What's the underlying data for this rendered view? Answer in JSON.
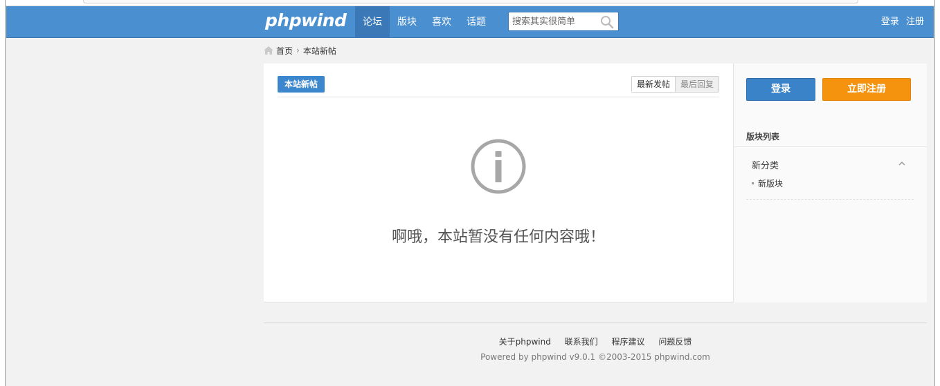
{
  "header": {
    "logo": "phpwind",
    "nav": [
      {
        "label": "论坛",
        "active": true
      },
      {
        "label": "版块",
        "active": false
      },
      {
        "label": "喜欢",
        "active": false
      },
      {
        "label": "话题",
        "active": false
      }
    ],
    "search_placeholder": "搜索其实很简单",
    "login_link": "登录",
    "register_link": "注册",
    "accent_color": "#4a8fcf"
  },
  "breadcrumb": {
    "home": "首页",
    "separator": "›",
    "current": "本站新帖"
  },
  "main": {
    "section_label": "本站新帖",
    "sort_tabs": [
      "最新发帖",
      "最后回复"
    ],
    "empty_message": "啊哦，本站暂没有任何内容哦！"
  },
  "sidebar": {
    "login_button": "登录",
    "register_button": "立即注册",
    "block_list_title": "版块列表",
    "category": "新分类",
    "forums": [
      "新版块"
    ]
  },
  "footer": {
    "links": [
      "关于phpwind",
      "联系我们",
      "程序建议",
      "问题反馈"
    ],
    "powered": "Powered by phpwind v9.0.1 ©2003-2015 phpwind.com"
  }
}
